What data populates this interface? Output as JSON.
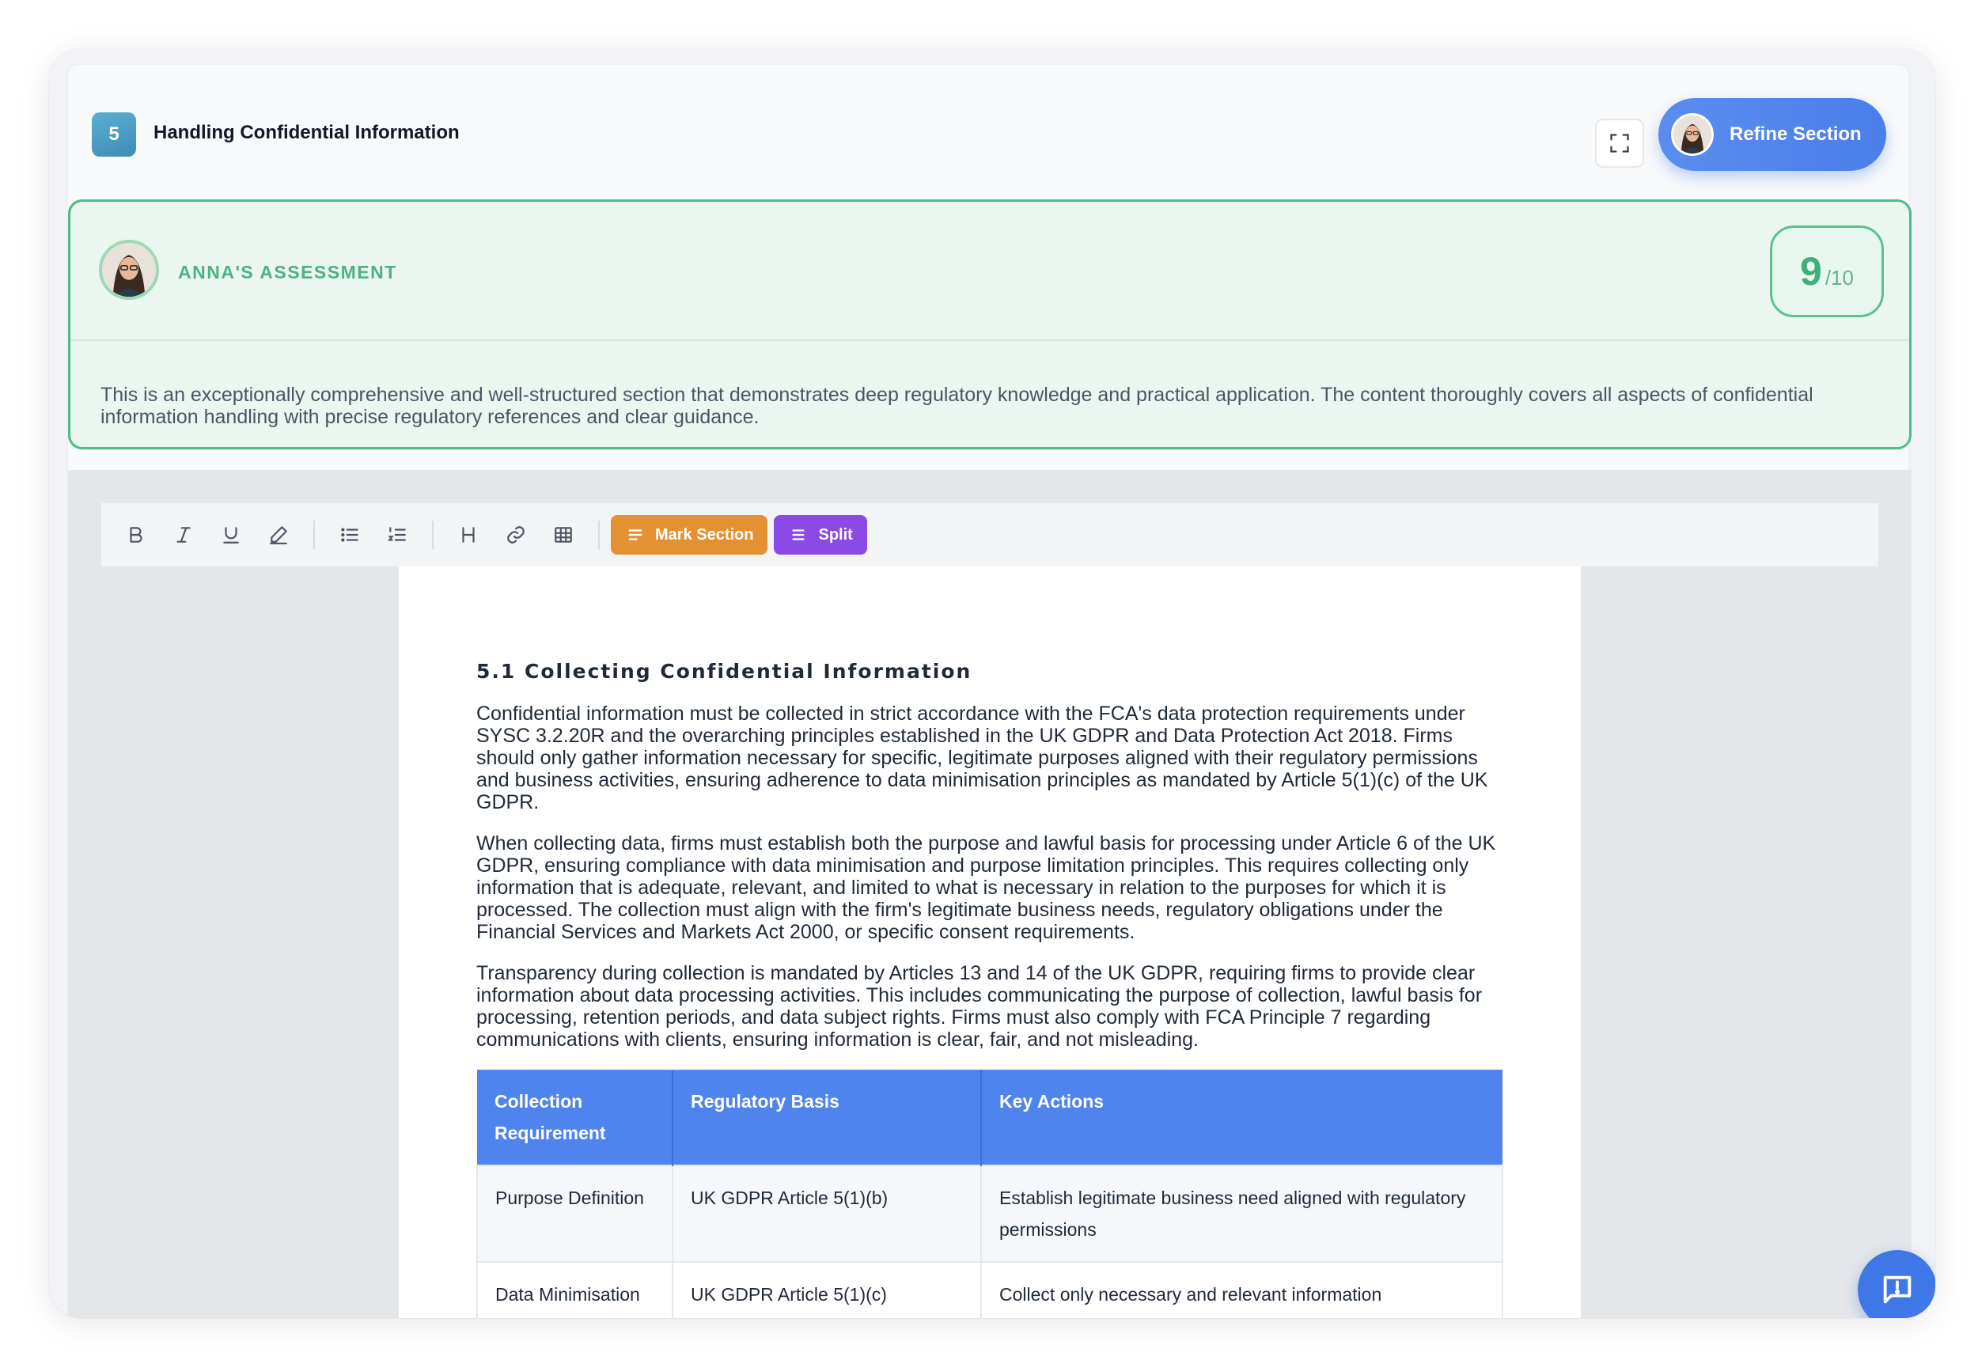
{
  "section": {
    "number": "5",
    "title": "Handling Confidential Information"
  },
  "header": {
    "expand_icon": "expand-icon",
    "refine_label": "Refine Section"
  },
  "assessment": {
    "label": "ANNA'S ASSESSMENT",
    "score": "9",
    "score_max": "/10",
    "text": "This is an exceptionally comprehensive and well-structured section that demonstrates deep regulatory knowledge and practical application. The content thoroughly covers all aspects of confidential information handling with precise regulatory references and clear guidance."
  },
  "toolbar": {
    "icons": [
      "bold-icon",
      "italic-icon",
      "underline-icon",
      "highlight-icon",
      "bullet-list-icon",
      "numbered-list-icon",
      "heading-icon",
      "link-icon",
      "table-icon"
    ],
    "mark_label": "Mark Section",
    "split_label": "Split",
    "mark_color": "#e39132",
    "split_color": "#8b4ae6"
  },
  "document": {
    "heading": "5.1 Collecting Confidential Information",
    "paragraphs": [
      "Confidential information must be collected in strict accordance with the FCA's data protection requirements under SYSC 3.2.20R and the overarching principles established in the UK GDPR and Data Protection Act 2018. Firms should only gather information necessary for specific, legitimate purposes aligned with their regulatory permissions and business activities, ensuring adherence to data minimisation principles as mandated by Article 5(1)(c) of the UK GDPR.",
      "When collecting data, firms must establish both the purpose and lawful basis for processing under Article 6 of the UK GDPR, ensuring compliance with data minimisation and purpose limitation principles. This requires collecting only information that is adequate, relevant, and limited to what is necessary in relation to the purposes for which it is processed. The collection must align with the firm's legitimate business needs, regulatory obligations under the Financial Services and Markets Act 2000, or specific consent requirements.",
      "Transparency during collection is mandated by Articles 13 and 14 of the UK GDPR, requiring firms to provide clear information about data processing activities. This includes communicating the purpose of collection, lawful basis for processing, retention periods, and data subject rights. Firms must also comply with FCA Principle 7 regarding communications with clients, ensuring information is clear, fair, and not misleading."
    ],
    "table": {
      "headers": [
        "Collection Requirement",
        "Regulatory Basis",
        "Key Actions"
      ],
      "rows": [
        [
          "Purpose Definition",
          "UK GDPR Article 5(1)(b)",
          "Establish legitimate business need aligned with regulatory permissions"
        ],
        [
          "Data Minimisation",
          "UK GDPR Article 5(1)(c)",
          "Collect only necessary and relevant information"
        ]
      ]
    }
  },
  "colors": {
    "accent_blue": "#4f83ee",
    "assessment_green": "#4cbd86"
  }
}
